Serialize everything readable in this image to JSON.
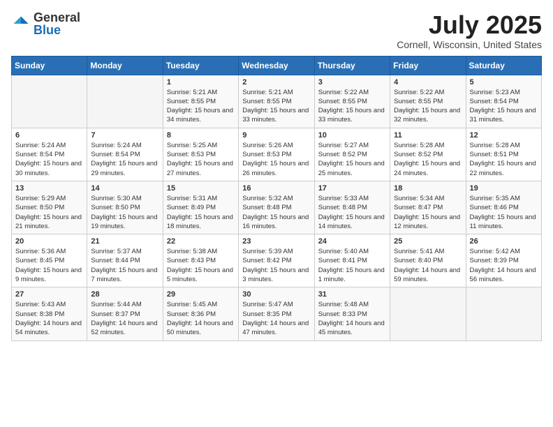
{
  "logo": {
    "general": "General",
    "blue": "Blue"
  },
  "header": {
    "month": "July 2025",
    "location": "Cornell, Wisconsin, United States"
  },
  "weekdays": [
    "Sunday",
    "Monday",
    "Tuesday",
    "Wednesday",
    "Thursday",
    "Friday",
    "Saturday"
  ],
  "weeks": [
    [
      {
        "day": "",
        "sunrise": "",
        "sunset": "",
        "daylight": ""
      },
      {
        "day": "",
        "sunrise": "",
        "sunset": "",
        "daylight": ""
      },
      {
        "day": "1",
        "sunrise": "Sunrise: 5:21 AM",
        "sunset": "Sunset: 8:55 PM",
        "daylight": "Daylight: 15 hours and 34 minutes."
      },
      {
        "day": "2",
        "sunrise": "Sunrise: 5:21 AM",
        "sunset": "Sunset: 8:55 PM",
        "daylight": "Daylight: 15 hours and 33 minutes."
      },
      {
        "day": "3",
        "sunrise": "Sunrise: 5:22 AM",
        "sunset": "Sunset: 8:55 PM",
        "daylight": "Daylight: 15 hours and 33 minutes."
      },
      {
        "day": "4",
        "sunrise": "Sunrise: 5:22 AM",
        "sunset": "Sunset: 8:55 PM",
        "daylight": "Daylight: 15 hours and 32 minutes."
      },
      {
        "day": "5",
        "sunrise": "Sunrise: 5:23 AM",
        "sunset": "Sunset: 8:54 PM",
        "daylight": "Daylight: 15 hours and 31 minutes."
      }
    ],
    [
      {
        "day": "6",
        "sunrise": "Sunrise: 5:24 AM",
        "sunset": "Sunset: 8:54 PM",
        "daylight": "Daylight: 15 hours and 30 minutes."
      },
      {
        "day": "7",
        "sunrise": "Sunrise: 5:24 AM",
        "sunset": "Sunset: 8:54 PM",
        "daylight": "Daylight: 15 hours and 29 minutes."
      },
      {
        "day": "8",
        "sunrise": "Sunrise: 5:25 AM",
        "sunset": "Sunset: 8:53 PM",
        "daylight": "Daylight: 15 hours and 27 minutes."
      },
      {
        "day": "9",
        "sunrise": "Sunrise: 5:26 AM",
        "sunset": "Sunset: 8:53 PM",
        "daylight": "Daylight: 15 hours and 26 minutes."
      },
      {
        "day": "10",
        "sunrise": "Sunrise: 5:27 AM",
        "sunset": "Sunset: 8:52 PM",
        "daylight": "Daylight: 15 hours and 25 minutes."
      },
      {
        "day": "11",
        "sunrise": "Sunrise: 5:28 AM",
        "sunset": "Sunset: 8:52 PM",
        "daylight": "Daylight: 15 hours and 24 minutes."
      },
      {
        "day": "12",
        "sunrise": "Sunrise: 5:28 AM",
        "sunset": "Sunset: 8:51 PM",
        "daylight": "Daylight: 15 hours and 22 minutes."
      }
    ],
    [
      {
        "day": "13",
        "sunrise": "Sunrise: 5:29 AM",
        "sunset": "Sunset: 8:50 PM",
        "daylight": "Daylight: 15 hours and 21 minutes."
      },
      {
        "day": "14",
        "sunrise": "Sunrise: 5:30 AM",
        "sunset": "Sunset: 8:50 PM",
        "daylight": "Daylight: 15 hours and 19 minutes."
      },
      {
        "day": "15",
        "sunrise": "Sunrise: 5:31 AM",
        "sunset": "Sunset: 8:49 PM",
        "daylight": "Daylight: 15 hours and 18 minutes."
      },
      {
        "day": "16",
        "sunrise": "Sunrise: 5:32 AM",
        "sunset": "Sunset: 8:48 PM",
        "daylight": "Daylight: 15 hours and 16 minutes."
      },
      {
        "day": "17",
        "sunrise": "Sunrise: 5:33 AM",
        "sunset": "Sunset: 8:48 PM",
        "daylight": "Daylight: 15 hours and 14 minutes."
      },
      {
        "day": "18",
        "sunrise": "Sunrise: 5:34 AM",
        "sunset": "Sunset: 8:47 PM",
        "daylight": "Daylight: 15 hours and 12 minutes."
      },
      {
        "day": "19",
        "sunrise": "Sunrise: 5:35 AM",
        "sunset": "Sunset: 8:46 PM",
        "daylight": "Daylight: 15 hours and 11 minutes."
      }
    ],
    [
      {
        "day": "20",
        "sunrise": "Sunrise: 5:36 AM",
        "sunset": "Sunset: 8:45 PM",
        "daylight": "Daylight: 15 hours and 9 minutes."
      },
      {
        "day": "21",
        "sunrise": "Sunrise: 5:37 AM",
        "sunset": "Sunset: 8:44 PM",
        "daylight": "Daylight: 15 hours and 7 minutes."
      },
      {
        "day": "22",
        "sunrise": "Sunrise: 5:38 AM",
        "sunset": "Sunset: 8:43 PM",
        "daylight": "Daylight: 15 hours and 5 minutes."
      },
      {
        "day": "23",
        "sunrise": "Sunrise: 5:39 AM",
        "sunset": "Sunset: 8:42 PM",
        "daylight": "Daylight: 15 hours and 3 minutes."
      },
      {
        "day": "24",
        "sunrise": "Sunrise: 5:40 AM",
        "sunset": "Sunset: 8:41 PM",
        "daylight": "Daylight: 15 hours and 1 minute."
      },
      {
        "day": "25",
        "sunrise": "Sunrise: 5:41 AM",
        "sunset": "Sunset: 8:40 PM",
        "daylight": "Daylight: 14 hours and 59 minutes."
      },
      {
        "day": "26",
        "sunrise": "Sunrise: 5:42 AM",
        "sunset": "Sunset: 8:39 PM",
        "daylight": "Daylight: 14 hours and 56 minutes."
      }
    ],
    [
      {
        "day": "27",
        "sunrise": "Sunrise: 5:43 AM",
        "sunset": "Sunset: 8:38 PM",
        "daylight": "Daylight: 14 hours and 54 minutes."
      },
      {
        "day": "28",
        "sunrise": "Sunrise: 5:44 AM",
        "sunset": "Sunset: 8:37 PM",
        "daylight": "Daylight: 14 hours and 52 minutes."
      },
      {
        "day": "29",
        "sunrise": "Sunrise: 5:45 AM",
        "sunset": "Sunset: 8:36 PM",
        "daylight": "Daylight: 14 hours and 50 minutes."
      },
      {
        "day": "30",
        "sunrise": "Sunrise: 5:47 AM",
        "sunset": "Sunset: 8:35 PM",
        "daylight": "Daylight: 14 hours and 47 minutes."
      },
      {
        "day": "31",
        "sunrise": "Sunrise: 5:48 AM",
        "sunset": "Sunset: 8:33 PM",
        "daylight": "Daylight: 14 hours and 45 minutes."
      },
      {
        "day": "",
        "sunrise": "",
        "sunset": "",
        "daylight": ""
      },
      {
        "day": "",
        "sunrise": "",
        "sunset": "",
        "daylight": ""
      }
    ]
  ]
}
